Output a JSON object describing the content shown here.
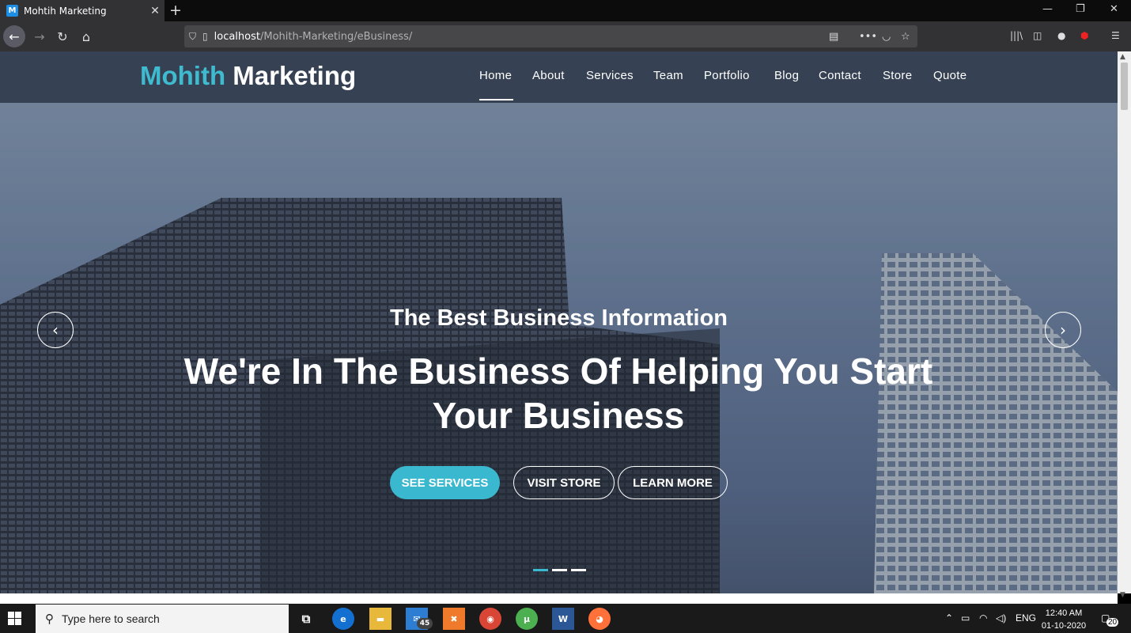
{
  "browser": {
    "tab_title": "Mohtih Marketing",
    "favicon_letter": "M",
    "url_host": "localhost",
    "url_path": "/Mohith-Marketing/eBusiness/"
  },
  "site": {
    "logo_part1": "Mohith",
    "logo_part2": "Marketing",
    "nav": [
      "Home",
      "About",
      "Services",
      "Team",
      "Portfolio",
      "Blog",
      "Contact",
      "Store",
      "Quote"
    ],
    "active_nav": "Home"
  },
  "hero": {
    "subtitle": "The Best Business Information",
    "title": "We're In The Business Of Helping You Start Your Business",
    "buttons": [
      "SEE SERVICES",
      "VISIT STORE",
      "LEARN MORE"
    ],
    "slides": 3,
    "active_slide": 1,
    "accent_color": "#3ab8cf"
  },
  "taskbar": {
    "search_placeholder": "Type here to search",
    "mail_badge": "45",
    "lang": "ENG",
    "time": "12:40 AM",
    "date": "01-10-2020",
    "notif_count": "20"
  }
}
